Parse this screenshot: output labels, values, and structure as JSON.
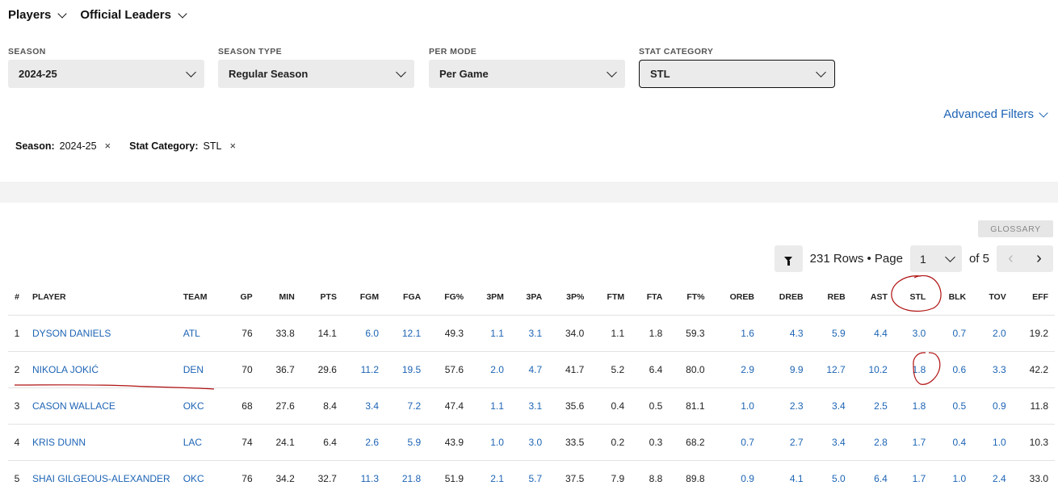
{
  "topnav": {
    "players": "Players",
    "leaders": "Official Leaders"
  },
  "filters": [
    {
      "label": "SEASON",
      "value": "2024-25"
    },
    {
      "label": "SEASON TYPE",
      "value": "Regular Season"
    },
    {
      "label": "PER MODE",
      "value": "Per Game"
    },
    {
      "label": "STAT CATEGORY",
      "value": "STL"
    }
  ],
  "advanced_filters": "Advanced Filters",
  "chips": [
    {
      "key": "Season:",
      "value": "2024-25",
      "close": "×"
    },
    {
      "key": "Stat Category:",
      "value": "STL",
      "close": "×"
    }
  ],
  "glossary": "GLOSSARY",
  "pager": {
    "rows_text": "231 Rows • Page",
    "page": "1",
    "of_text": "of 5",
    "prev": "‹",
    "next": "›"
  },
  "table": {
    "columns": [
      "#",
      "PLAYER",
      "TEAM",
      "GP",
      "MIN",
      "PTS",
      "FGM",
      "FGA",
      "FG%",
      "3PM",
      "3PA",
      "3P%",
      "FTM",
      "FTA",
      "FT%",
      "OREB",
      "DREB",
      "REB",
      "AST",
      "STL",
      "BLK",
      "TOV",
      "EFF"
    ],
    "rows": [
      [
        "1",
        "DYSON DANIELS",
        "ATL",
        "76",
        "33.8",
        "14.1",
        "6.0",
        "12.1",
        "49.3",
        "1.1",
        "3.1",
        "34.0",
        "1.1",
        "1.8",
        "59.3",
        "1.6",
        "4.3",
        "5.9",
        "4.4",
        "3.0",
        "0.7",
        "2.0",
        "19.2"
      ],
      [
        "2",
        "NIKOLA JOKIĆ",
        "DEN",
        "70",
        "36.7",
        "29.6",
        "11.2",
        "19.5",
        "57.6",
        "2.0",
        "4.7",
        "41.7",
        "5.2",
        "6.4",
        "80.0",
        "2.9",
        "9.9",
        "12.7",
        "10.2",
        "1.8",
        "0.6",
        "3.3",
        "42.2"
      ],
      [
        "3",
        "CASON WALLACE",
        "OKC",
        "68",
        "27.6",
        "8.4",
        "3.4",
        "7.2",
        "47.4",
        "1.1",
        "3.1",
        "35.6",
        "0.4",
        "0.5",
        "81.1",
        "1.0",
        "2.3",
        "3.4",
        "2.5",
        "1.8",
        "0.5",
        "0.9",
        "11.8"
      ],
      [
        "4",
        "KRIS DUNN",
        "LAC",
        "74",
        "24.1",
        "6.4",
        "2.6",
        "5.9",
        "43.9",
        "1.0",
        "3.0",
        "33.5",
        "0.2",
        "0.3",
        "68.2",
        "0.7",
        "2.7",
        "3.4",
        "2.8",
        "1.7",
        "0.4",
        "1.0",
        "10.3"
      ],
      [
        "5",
        "SHAI GILGEOUS-ALEXANDER",
        "OKC",
        "76",
        "34.2",
        "32.7",
        "11.3",
        "21.8",
        "51.9",
        "2.1",
        "5.7",
        "37.5",
        "7.9",
        "8.8",
        "89.8",
        "0.9",
        "4.1",
        "5.0",
        "6.4",
        "1.7",
        "1.0",
        "2.4",
        "33.0"
      ]
    ]
  },
  "colors": {
    "link": "#1d64b5",
    "annotation": "#b01010"
  }
}
